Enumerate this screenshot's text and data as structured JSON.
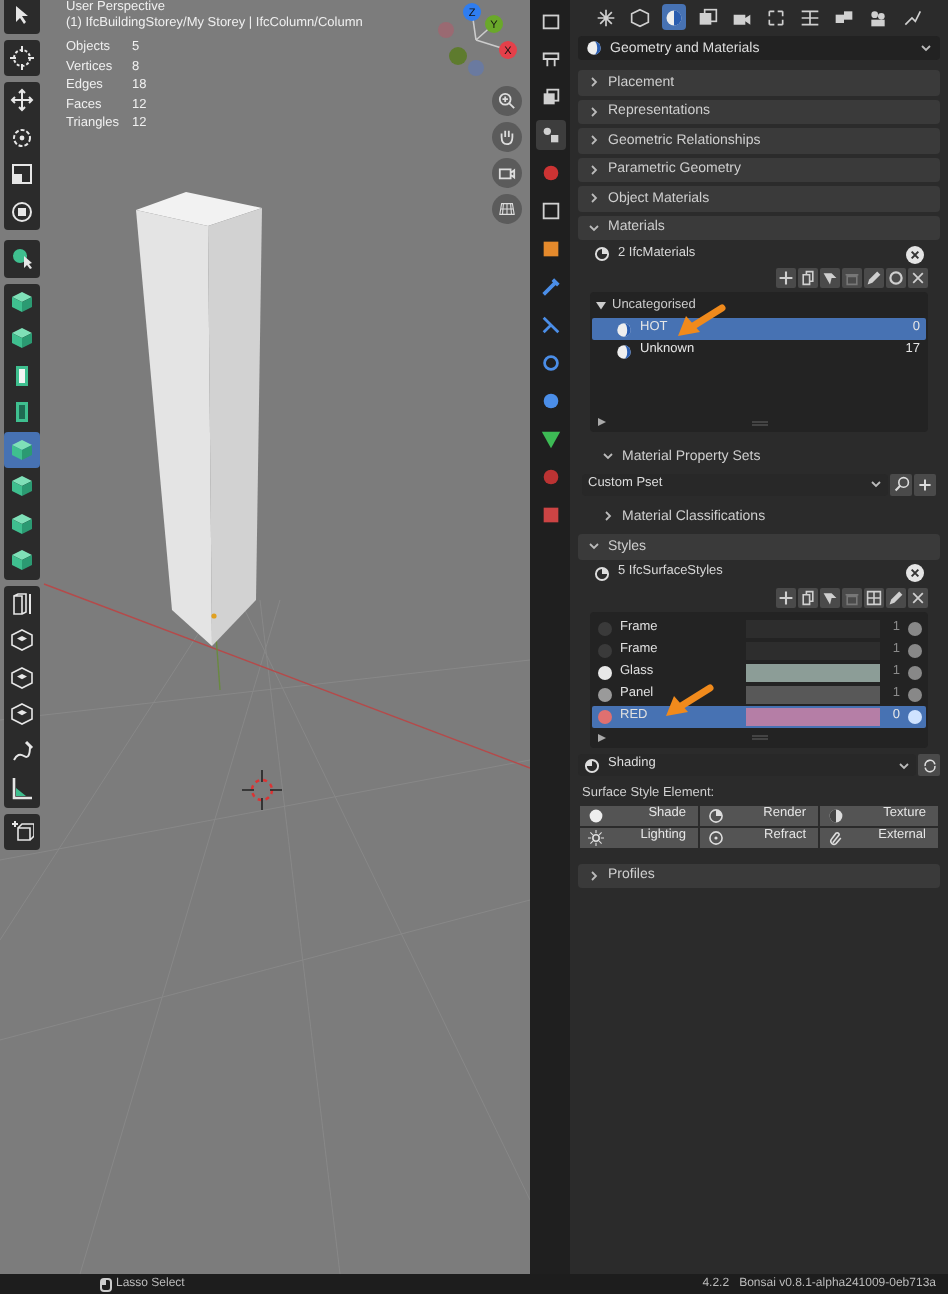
{
  "viewport": {
    "view_name": "User Perspective",
    "context": "(1) IfcBuildingStorey/My Storey | IfcColumn/Column",
    "stats": [
      {
        "label": "Objects",
        "value": "5"
      },
      {
        "label": "Vertices",
        "value": "8"
      },
      {
        "label": "Edges",
        "value": "18"
      },
      {
        "label": "Faces",
        "value": "12"
      },
      {
        "label": "Triangles",
        "value": "12"
      }
    ],
    "axes": [
      "Z",
      "Y",
      "X"
    ]
  },
  "tool_groups": [
    [
      {
        "selected": false
      }
    ],
    [
      {
        "selected": false
      }
    ],
    [
      {
        "selected": false
      },
      {
        "selected": false
      },
      {
        "selected": false
      },
      {
        "selected": false
      }
    ],
    [
      {
        "selected": false
      }
    ],
    [
      {
        "selected": false
      },
      {
        "selected": false
      },
      {
        "selected": false
      },
      {
        "selected": false
      },
      {
        "selected": true
      },
      {
        "selected": false
      },
      {
        "selected": false
      },
      {
        "selected": false
      }
    ],
    [
      {
        "selected": false
      },
      {
        "selected": false
      },
      {
        "selected": false
      },
      {
        "selected": false
      },
      {
        "selected": false
      },
      {
        "selected": false
      }
    ],
    [
      {
        "selected": false
      }
    ]
  ],
  "side_tabs": [
    {
      "selected": false
    },
    {
      "selected": false
    },
    {
      "selected": false
    },
    {
      "selected": true
    },
    {
      "selected": false
    },
    {
      "selected": false
    },
    {
      "selected": false
    },
    {
      "selected": false
    },
    {
      "selected": false
    },
    {
      "selected": false
    },
    {
      "selected": false
    },
    {
      "selected": false
    },
    {
      "selected": false
    },
    {
      "selected": false
    }
  ],
  "top_tabs": [
    {
      "selected": false
    },
    {
      "selected": false
    },
    {
      "selected": true
    },
    {
      "selected": false
    },
    {
      "selected": false
    },
    {
      "selected": false
    },
    {
      "selected": false
    },
    {
      "selected": false
    },
    {
      "selected": false
    },
    {
      "selected": false
    }
  ],
  "editor": {
    "title": "Geometry and Materials"
  },
  "collapsed_panels": [
    {
      "label": "Placement",
      "expanded": false
    },
    {
      "label": "Representations",
      "expanded": false
    },
    {
      "label": "Geometric Relationships",
      "expanded": false
    },
    {
      "label": "Parametric Geometry",
      "expanded": false
    },
    {
      "label": "Object Materials",
      "expanded": false
    }
  ],
  "materials": {
    "label": "Materials",
    "expanded": true,
    "summary": "2 IfcMaterials",
    "category": "Uncategorised",
    "category_expanded": true,
    "items": [
      {
        "name": "HOT",
        "count": "0",
        "selected": true
      },
      {
        "name": "Unknown",
        "count": "17",
        "selected": false
      }
    ],
    "pset_panel": {
      "label": "Material Property Sets",
      "expanded": true,
      "value": "Custom Pset"
    },
    "classification_panel": {
      "label": "Material Classifications",
      "expanded": false
    }
  },
  "styles": {
    "label": "Styles",
    "expanded": true,
    "summary": "5 IfcSurfaceStyles",
    "items": [
      {
        "name": "Frame",
        "count": "1",
        "swatch": {
          "color": "#2d2d2d"
        },
        "sphere": {
          "color": "#3a3a3a"
        },
        "selected": false
      },
      {
        "name": "Frame",
        "count": "1",
        "swatch": {
          "color": "#2d2d2d"
        },
        "sphere": {
          "color": "#3a3a3a"
        },
        "selected": false
      },
      {
        "name": "Glass",
        "count": "1",
        "swatch": {
          "color": "#8c9d97"
        },
        "sphere": {
          "color": "#e8e8e8"
        },
        "selected": false
      },
      {
        "name": "Panel",
        "count": "1",
        "swatch": {
          "color": "#585858"
        },
        "sphere": {
          "color": "#9a9a9a"
        },
        "selected": false
      },
      {
        "name": "RED",
        "count": "0",
        "swatch": {
          "color": "#b57ea6"
        },
        "sphere": {
          "color": "#e07070"
        },
        "selected": true
      }
    ],
    "shading": "Shading",
    "element_label": "Surface Style Element:",
    "element_buttons": [
      "Shade",
      "Render",
      "Texture",
      "Lighting",
      "Refract",
      "External"
    ]
  },
  "profiles": {
    "label": "Profiles",
    "expanded": false
  },
  "status_bar": {
    "hint": "Lasso Select",
    "version": "4.2.2",
    "addon": "Bonsai v0.8.1-alpha241009-0eb713a"
  }
}
